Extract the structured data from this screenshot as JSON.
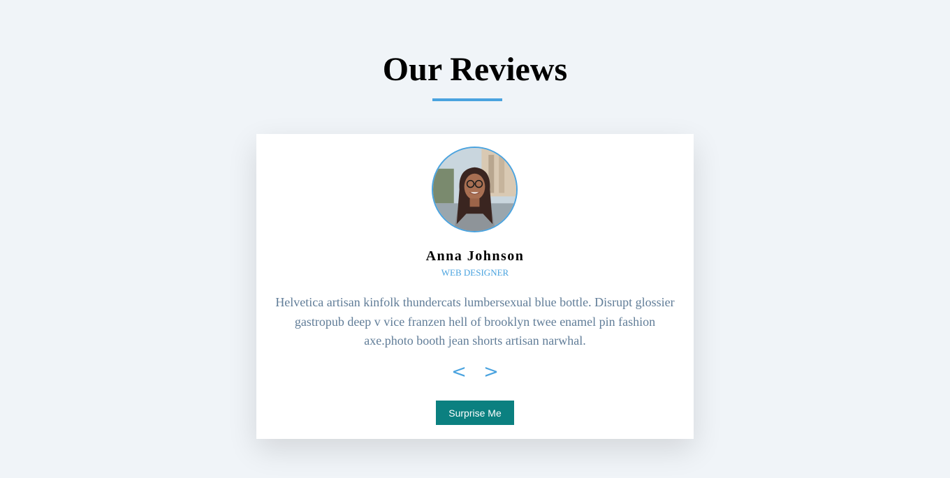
{
  "header": {
    "title": "Our Reviews"
  },
  "review": {
    "name": "Anna Johnson",
    "job": "WEB DESIGNER",
    "text": "Helvetica artisan kinfolk thundercats lumbersexual blue bottle. Disrupt glossier gastropub deep v vice franzen hell of brooklyn twee enamel pin fashion axe.photo booth jean shorts artisan narwhal.",
    "prev_label": "<",
    "next_label": ">",
    "surprise_label": "Surprise Me"
  },
  "colors": {
    "background": "#f0f4f8",
    "accent": "#4aa3df",
    "button": "#0b8080",
    "text": "#617d98"
  }
}
